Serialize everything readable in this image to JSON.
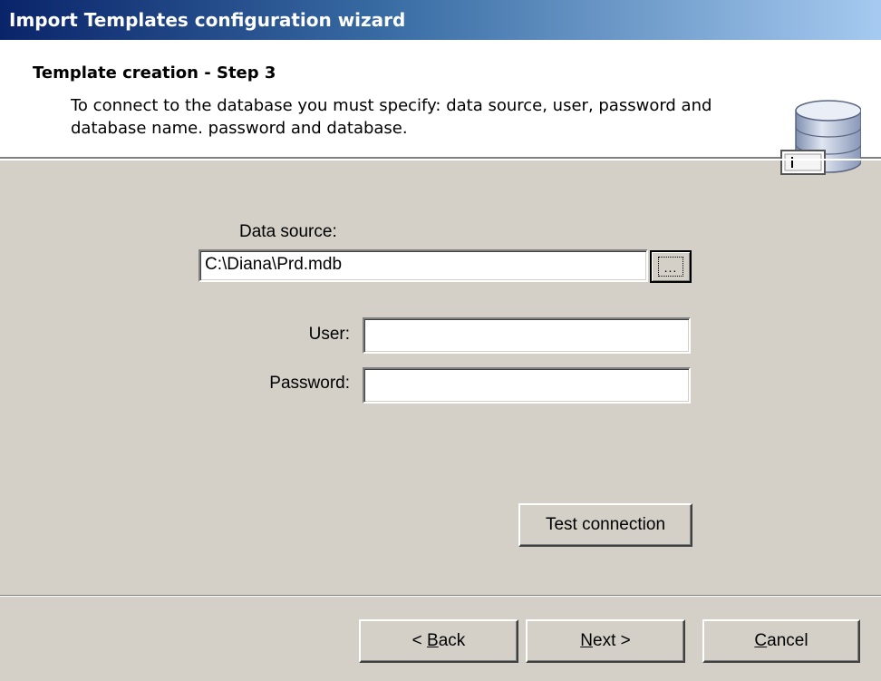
{
  "window": {
    "title": "Import Templates configuration wizard"
  },
  "header": {
    "step_title": "Template creation - Step 3",
    "description": "To connect to the database you must specify: data source, user, password and database name. password and database.",
    "icon": "database-icon"
  },
  "form": {
    "data_source_label": "Data source:",
    "data_source_value": "C:\\Diana\\Prd.mdb",
    "browse_label": "...",
    "user_label": "User:",
    "user_value": "",
    "password_label": "Password:",
    "password_value": "",
    "test_connection_label": "Test connection"
  },
  "footer": {
    "back_prefix": "< ",
    "back_accel": "B",
    "back_rest": "ack",
    "next_accel": "N",
    "next_rest": "ext >",
    "cancel_accel": "C",
    "cancel_rest": "ancel"
  },
  "colors": {
    "title_gradient_start": "#0a246a",
    "title_gradient_end": "#a6caf0",
    "dialog_face": "#d4d0c8"
  }
}
